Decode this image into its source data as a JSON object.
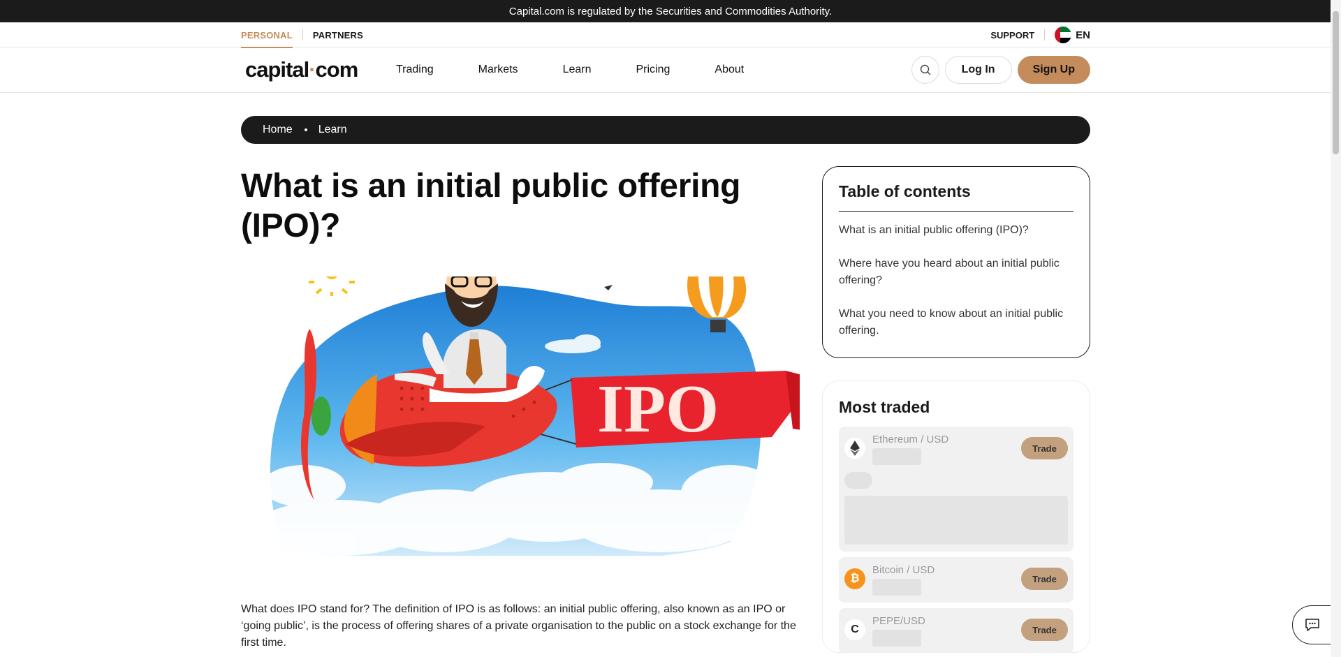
{
  "notice": "Capital.com is regulated by the Securities and Commodities Authority.",
  "topnav": {
    "segments": [
      "PERSONAL",
      "PARTNERS"
    ],
    "support": "SUPPORT",
    "lang": "EN"
  },
  "logo": {
    "pre": "capital",
    "dot": "·",
    "post": "com"
  },
  "menu": [
    "Trading",
    "Markets",
    "Learn",
    "Pricing",
    "About"
  ],
  "auth": {
    "login": "Log In",
    "signup": "Sign Up"
  },
  "breadcrumb": [
    "Home",
    "Learn"
  ],
  "article": {
    "title": "What is an initial public offering (IPO)?",
    "hero_banner_text": "IPO",
    "intro": "What does IPO stand for? The definition of IPO is as follows: an initial public offering, also known as an IPO or ‘going public’, is the process of offering shares of a private organisation to the public on a stock exchange for the first time."
  },
  "toc": {
    "title": "Table of contents",
    "items": [
      "What is an initial public offering (IPO)?",
      "Where have you heard about an initial public offering?",
      "What you need to know about an initial public offering."
    ]
  },
  "most_traded": {
    "title": "Most traded",
    "items": [
      {
        "pair": "Ethereum / USD",
        "icon": "ethereum-icon",
        "button": "Trade"
      },
      {
        "pair": "Bitcoin / USD",
        "icon": "bitcoin-icon",
        "icon_glyph": "₿",
        "button": "Trade"
      },
      {
        "pair": "PEPE/USD",
        "icon": "pepe-icon",
        "icon_glyph": "C",
        "button": "Trade"
      }
    ]
  },
  "colors": {
    "accent": "#c48b5b",
    "dark": "#1b1b1b",
    "trade_button": "#c3a07e"
  }
}
